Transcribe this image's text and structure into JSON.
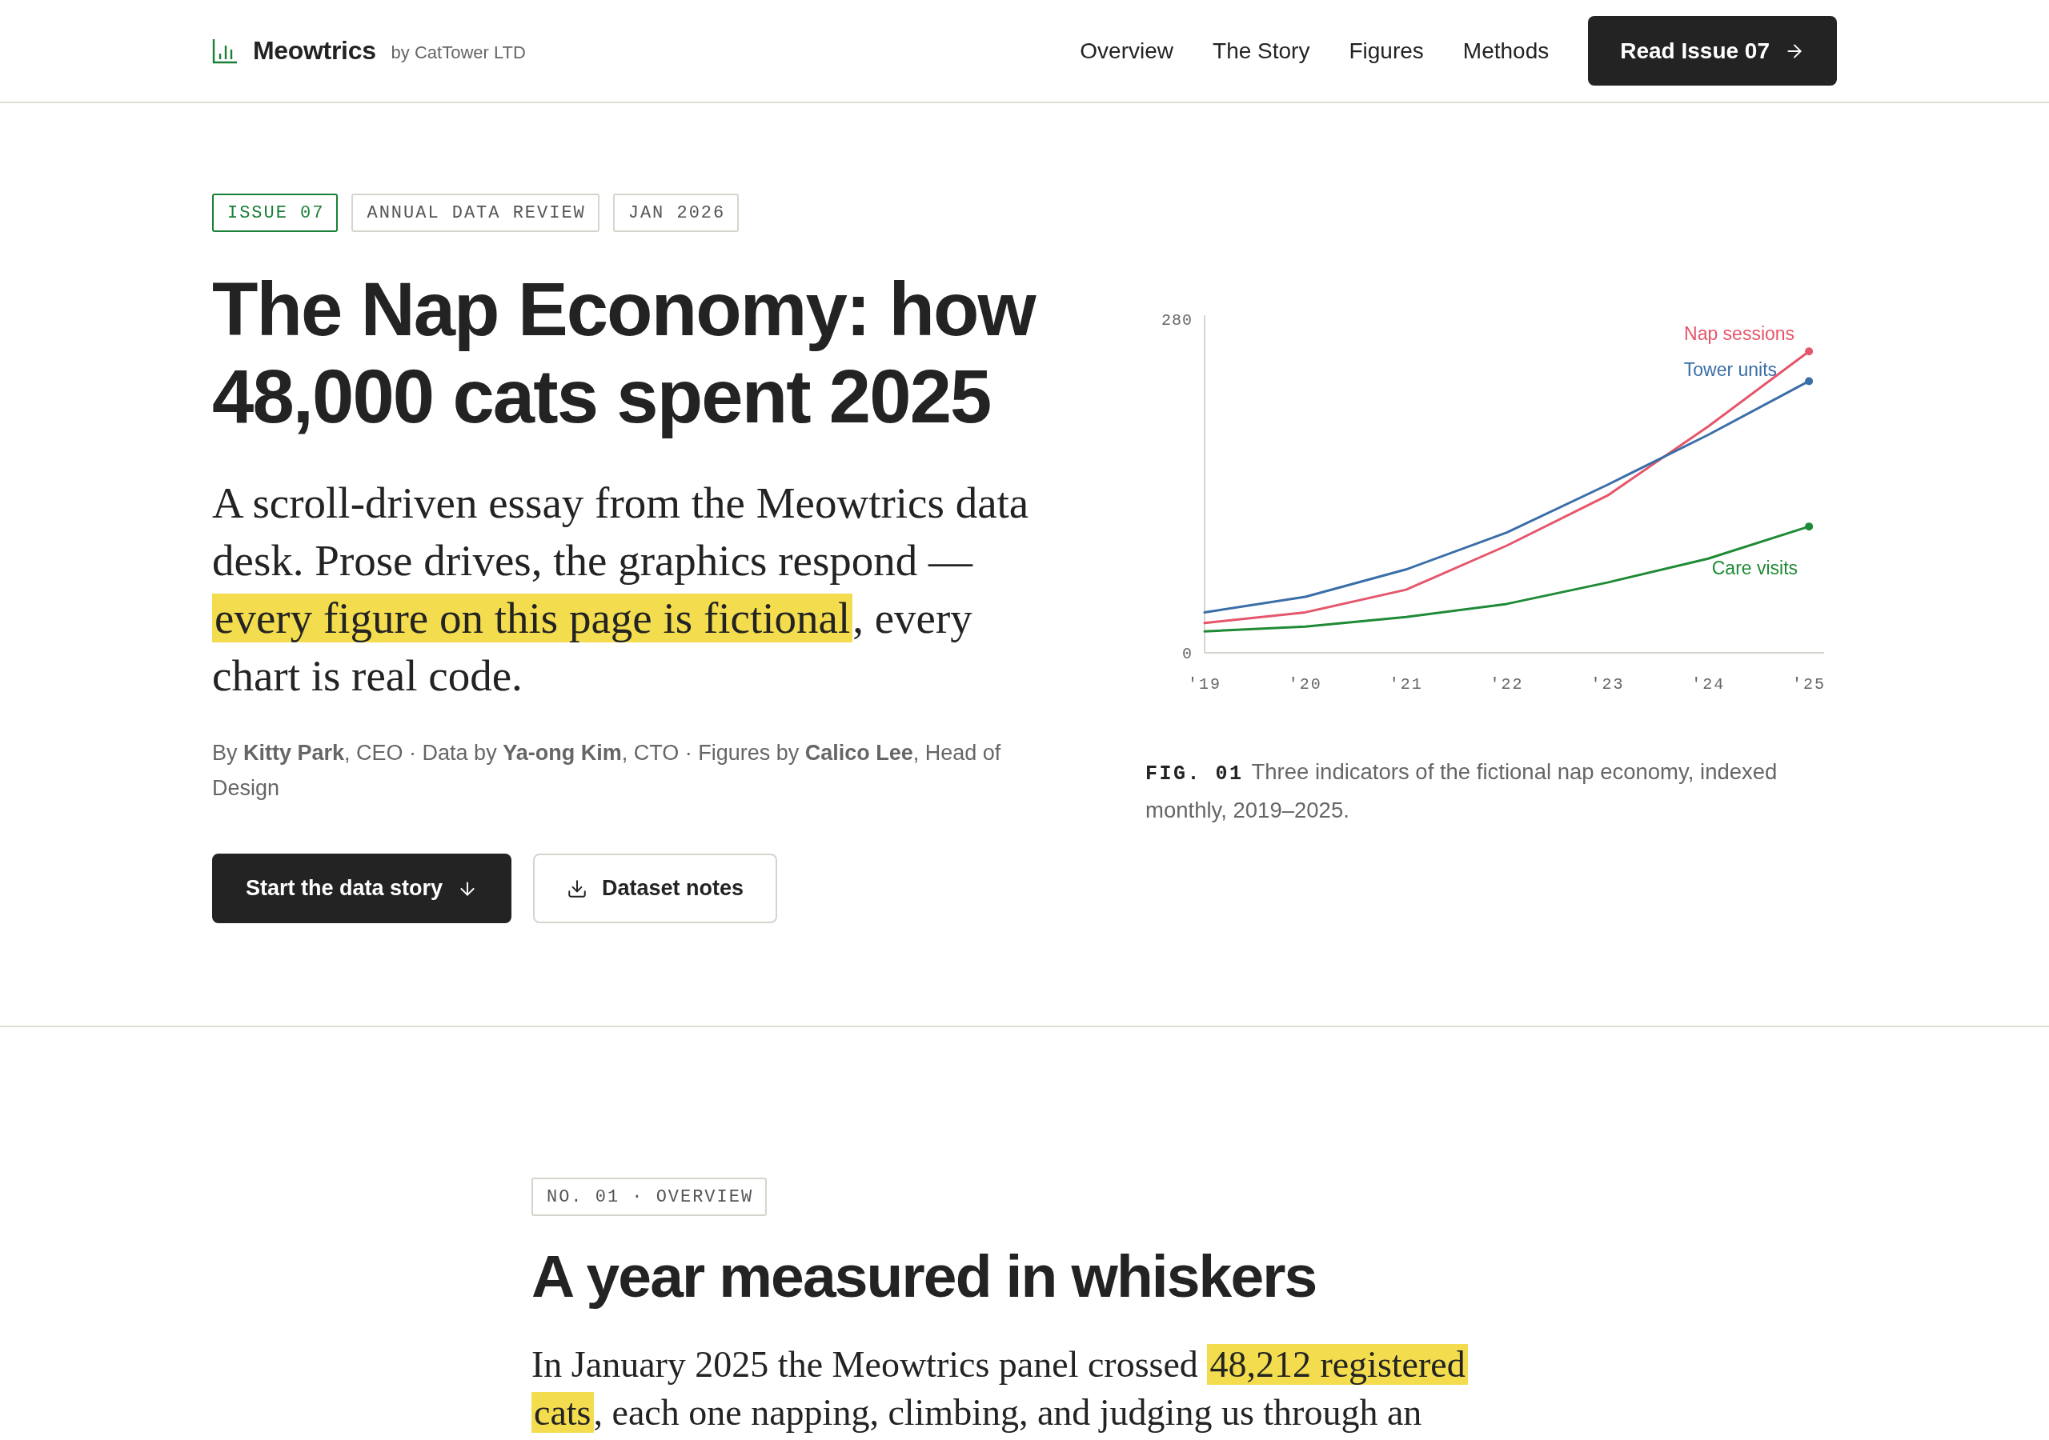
{
  "header": {
    "brand": {
      "name": "Meowtrics",
      "byline": "by CatTower LTD"
    },
    "nav": [
      "Overview",
      "The Story",
      "Figures",
      "Methods"
    ],
    "cta": {
      "label": "Read Issue 07"
    }
  },
  "hero": {
    "tags": [
      {
        "label": "ISSUE 07",
        "kind": "accent"
      },
      {
        "label": "ANNUAL DATA REVIEW",
        "kind": "plain"
      },
      {
        "label": "JAN 2026",
        "kind": "plain"
      }
    ],
    "title": "The Nap Economy: how 48,000 cats spent 2025",
    "lead": [
      {
        "text": "A scroll-driven essay from the Meowtrics data desk. Prose drives, the graphics respond — ",
        "highlighted": false
      },
      {
        "text": "every figure on this page is fictional",
        "highlighted": true
      },
      {
        "text": ", every chart is real code.",
        "highlighted": false
      }
    ],
    "byline": "By **Kitty Park**, CEO · Data by **Ya-ong Kim**, CTO · Figures by **Calico Lee**, Head of Design",
    "actions": [
      {
        "label": "Start the data story",
        "kind": "primary"
      },
      {
        "label": "Dataset notes",
        "kind": "secondary"
      }
    ],
    "figure": {
      "chart_data": {
        "type": "line",
        "x": [
          2019,
          2020,
          2021,
          2022,
          2023,
          2024,
          2025
        ],
        "xlim": [
          2019,
          2025.15
        ],
        "ylim": [
          0,
          280
        ],
        "yticks": [
          0,
          280
        ],
        "xticks": [
          {
            "value": 2019,
            "label": "'19"
          },
          {
            "value": 2020,
            "label": "'20"
          },
          {
            "value": 2021,
            "label": "'21"
          },
          {
            "value": 2022,
            "label": "'22"
          },
          {
            "value": 2023,
            "label": "'23"
          },
          {
            "value": 2024,
            "label": "'24"
          },
          {
            "value": 2025,
            "label": "'25"
          }
        ],
        "legend": "right",
        "series": [
          {
            "name": "Nap sessions",
            "color": "#e5566a",
            "values": [
              25,
              34,
              53,
              90,
              132,
              190,
              253
            ]
          },
          {
            "name": "Tower units",
            "color": "#3a6ea8",
            "values": [
              34,
              47,
              70,
              101,
              141,
              183,
              228
            ]
          },
          {
            "name": "Care visits",
            "color": "#1f8a36",
            "values": [
              18,
              22,
              30,
              41,
              59,
              79,
              106
            ]
          }
        ]
      },
      "label": "FIG. 01",
      "caption": "Three indicators of the fictional nap economy, indexed monthly, 2019–2025."
    }
  },
  "section": {
    "tag": "NO. 01 · OVERVIEW",
    "title": "A year measured in whiskers",
    "body": [
      {
        "text": "In January 2025 the Meowtrics panel crossed ",
        "highlighted": false
      },
      {
        "text": "48,212 registered cats",
        "highlighted": true
      },
      {
        "text": ", each one napping, climbing, and judging us through an",
        "highlighted": false
      }
    ]
  }
}
